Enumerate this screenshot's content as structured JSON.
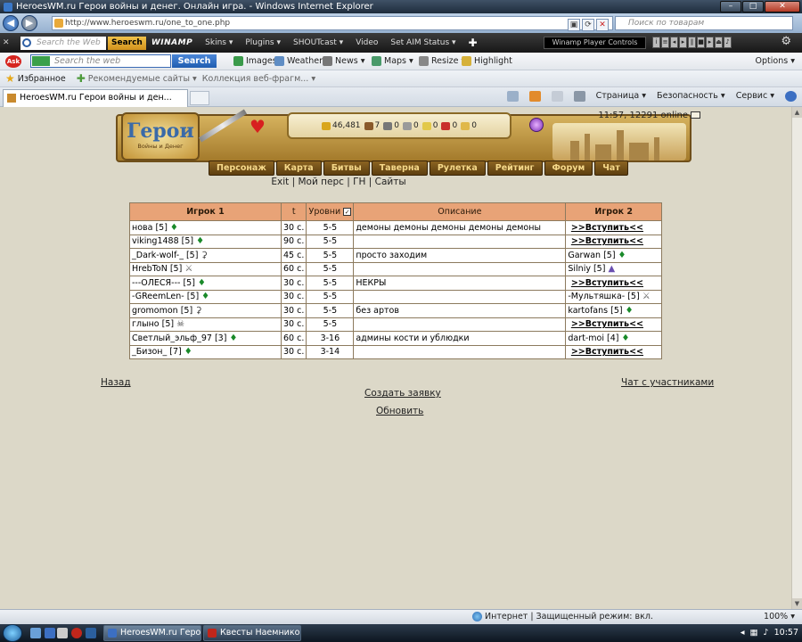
{
  "window": {
    "title": "HeroesWM.ru Герои войны и денег. Онлайн игра. - Windows Internet Explorer"
  },
  "address": {
    "url": "http://www.heroeswm.ru/one_to_one.php",
    "search_placeholder": "Поиск по товарам"
  },
  "winamp": {
    "search_placeholder": "Search the Web",
    "search_button": "Search",
    "logo": "WINAMP",
    "menus": [
      "Skins ▾",
      "Plugins ▾",
      "SHOUTcast ▾",
      "Video",
      "Set AIM Status ▾"
    ],
    "player_label": "Winamp Player Controls"
  },
  "ask": {
    "logo": "Ask",
    "search_placeholder": "Search the web",
    "search_button": "Search",
    "items": [
      "Images",
      "Weather",
      "News ▾",
      "Maps ▾",
      "Resize ▾",
      "Highlight"
    ],
    "options": "Options ▾"
  },
  "favorites": {
    "label": "Избранное",
    "items": [
      "Рекомендуемые сайты ▾",
      "Коллекция веб-фрагм... ▾"
    ]
  },
  "tab": {
    "title": "HeroesWM.ru Герои войны и ден..."
  },
  "command_bar": {
    "page": "Страница ▾",
    "security": "Безопасность ▾",
    "service": "Сервис ▾"
  },
  "game": {
    "logo_title": "Герои",
    "logo_subtitle": "Войны и Денег",
    "time_online": "11:57, 12291 online",
    "resources": [
      {
        "name": "gold",
        "value": "46,481",
        "color": "#d9a61c"
      },
      {
        "name": "wood",
        "value": "7",
        "color": "#8a5a2a"
      },
      {
        "name": "ore",
        "value": "0",
        "color": "#777777"
      },
      {
        "name": "mercury",
        "value": "0",
        "color": "#9a9a9a"
      },
      {
        "name": "sulfur",
        "value": "0",
        "color": "#e2c84a"
      },
      {
        "name": "crystal",
        "value": "0",
        "color": "#c9302c"
      },
      {
        "name": "gems",
        "value": "0",
        "color": "#e0b84a"
      }
    ],
    "nav": [
      "Персонаж",
      "Карта",
      "Битвы",
      "Таверна",
      "Рулетка",
      "Рейтинг",
      "Форум",
      "Чат"
    ],
    "sublinks": [
      "Exit",
      "Мой перс",
      "ГН",
      "Сайты"
    ]
  },
  "table": {
    "headers": {
      "player1": "Игрок 1",
      "t": "t",
      "levels": "Уровни",
      "description": "Описание",
      "player2": "Игрок 2"
    },
    "join_label": ">>Вступить<<",
    "rows": [
      {
        "p1": "нова [5]",
        "p1_icon": "leaf",
        "t": "30 с.",
        "lvl": "5-5",
        "desc": "демоны демоны демоны демоны демоны",
        "p2": "",
        "p2_icon": "",
        "join": true
      },
      {
        "p1": "viking1488 [5]",
        "p1_icon": "leaf",
        "t": "90 с.",
        "lvl": "5-5",
        "desc": "",
        "p2": "",
        "p2_icon": "",
        "join": true
      },
      {
        "p1": "_Dark-wolf-_ [5]",
        "p1_icon": "hook",
        "t": "45 с.",
        "lvl": "5-5",
        "desc": "просто заходим",
        "p2": "Garwan [5]",
        "p2_icon": "leaf",
        "join": false
      },
      {
        "p1": "HrebToN [5]",
        "p1_icon": "sword",
        "t": "60 с.",
        "lvl": "5-5",
        "desc": "",
        "p2": "Silniy [5]",
        "p2_icon": "wiz",
        "join": false
      },
      {
        "p1": "---ОЛЕСЯ--- [5]",
        "p1_icon": "leaf",
        "t": "30 с.",
        "lvl": "5-5",
        "desc": "НЕКРЫ",
        "p2": "",
        "p2_icon": "",
        "join": true
      },
      {
        "p1": "-GReemLen- [5]",
        "p1_icon": "leaf",
        "t": "30 с.",
        "lvl": "5-5",
        "desc": "",
        "p2": "-Мультяшка- [5]",
        "p2_icon": "sword",
        "join": false
      },
      {
        "p1": "gromomon [5]",
        "p1_icon": "hook",
        "t": "30 с.",
        "lvl": "5-5",
        "desc": "без артов",
        "p2": "kartofans [5]",
        "p2_icon": "leaf",
        "join": false
      },
      {
        "p1": "глыно [5]",
        "p1_icon": "skull",
        "t": "30 с.",
        "lvl": "5-5",
        "desc": "",
        "p2": "",
        "p2_icon": "",
        "join": true
      },
      {
        "p1": "Светлый_эльф_97 [3]",
        "p1_icon": "leaf",
        "t": "60 с.",
        "lvl": "3-16",
        "desc": "админы кости и ублюдки",
        "p2": "dart-moi [4]",
        "p2_icon": "leaf",
        "join": false
      },
      {
        "p1": "_Бизон_ [7]",
        "p1_icon": "leaf",
        "t": "30 с.",
        "lvl": "3-14",
        "desc": "",
        "p2": "",
        "p2_icon": "",
        "join": true
      }
    ]
  },
  "links": {
    "back": "Назад",
    "chat": "Чат с участниками",
    "create": "Создать заявку",
    "refresh": "Обновить"
  },
  "status": {
    "zone": "Интернет | Защищенный режим: вкл.",
    "zoom": "100% ▾"
  },
  "taskbar": {
    "tasks": [
      "HeroesWM.ru Геро...",
      "Квесты Наемников..."
    ],
    "clock": "10:57"
  }
}
